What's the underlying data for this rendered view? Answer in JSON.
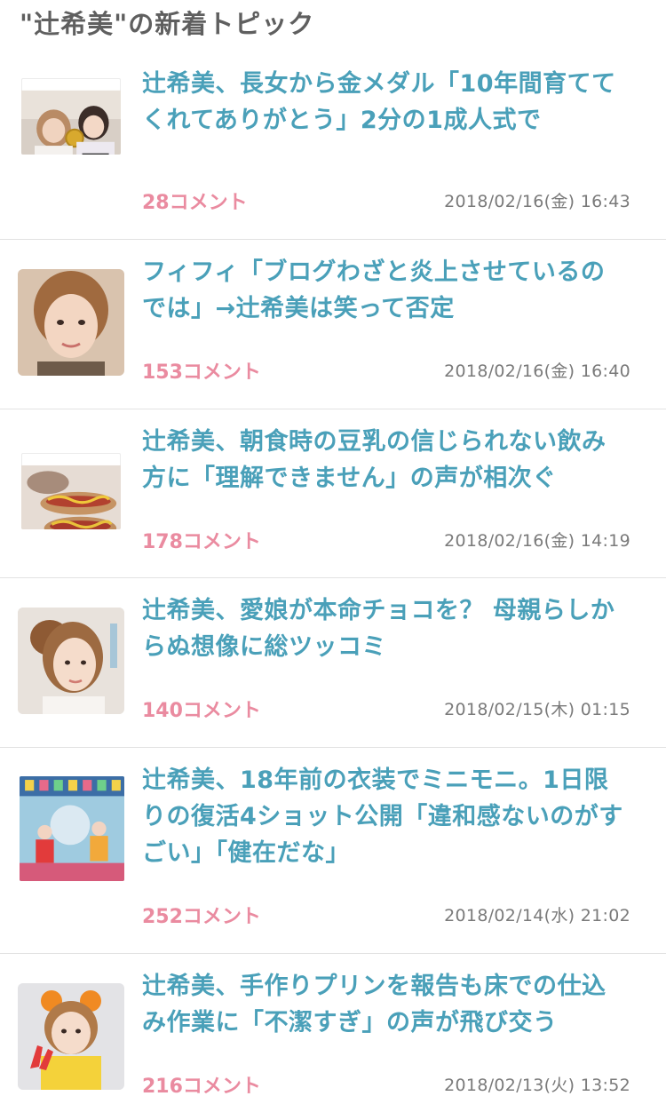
{
  "header": {
    "title": "\"辻希美\"の新着トピック"
  },
  "topics": [
    {
      "title": "辻希美、長女から金メダル「10年間育ててくれてありがとう」2分の1成人式で",
      "comments": "28コメント",
      "date": "2018/02/16(金) 16:43",
      "thumbnail": "photo-two-people-gold-medal"
    },
    {
      "title": "フィフィ「ブログわざと炎上させているのでは」→辻希美は笑って否定",
      "comments": "153コメント",
      "date": "2018/02/16(金) 16:40",
      "thumbnail": "photo-woman-portrait"
    },
    {
      "title": "辻希美、朝食時の豆乳の信じられない飲み方に「理解できません」の声が相次ぐ",
      "comments": "178コメント",
      "date": "2018/02/16(金) 14:19",
      "thumbnail": "photo-hotdog-breakfast"
    },
    {
      "title": "辻希美、愛娘が本命チョコを？ 母親らしからぬ想像に総ツッコミ",
      "comments": "140コメント",
      "date": "2018/02/15(木) 01:15",
      "thumbnail": "photo-woman-ponytail"
    },
    {
      "title": "辻希美、18年前の衣装でミニモニ。1日限りの復活4ショット公開「違和感ないのがすごい」「健在だな」",
      "comments": "252コメント",
      "date": "2018/02/14(水) 21:02",
      "thumbnail": "photo-stage-costumes"
    },
    {
      "title": "辻希美、手作りプリンを報告も床での仕込み作業に「不潔すぎ」の声が飛び交う",
      "comments": "216コメント",
      "date": "2018/02/13(火) 13:52",
      "thumbnail": "photo-costume-peace-sign"
    }
  ],
  "colors": {
    "title_link": "#4aa0b9",
    "comment_count": "#ea8ba0",
    "date_text": "#7a7a7a",
    "header_text": "#5f5f5f",
    "divider": "#e2e2e2"
  }
}
